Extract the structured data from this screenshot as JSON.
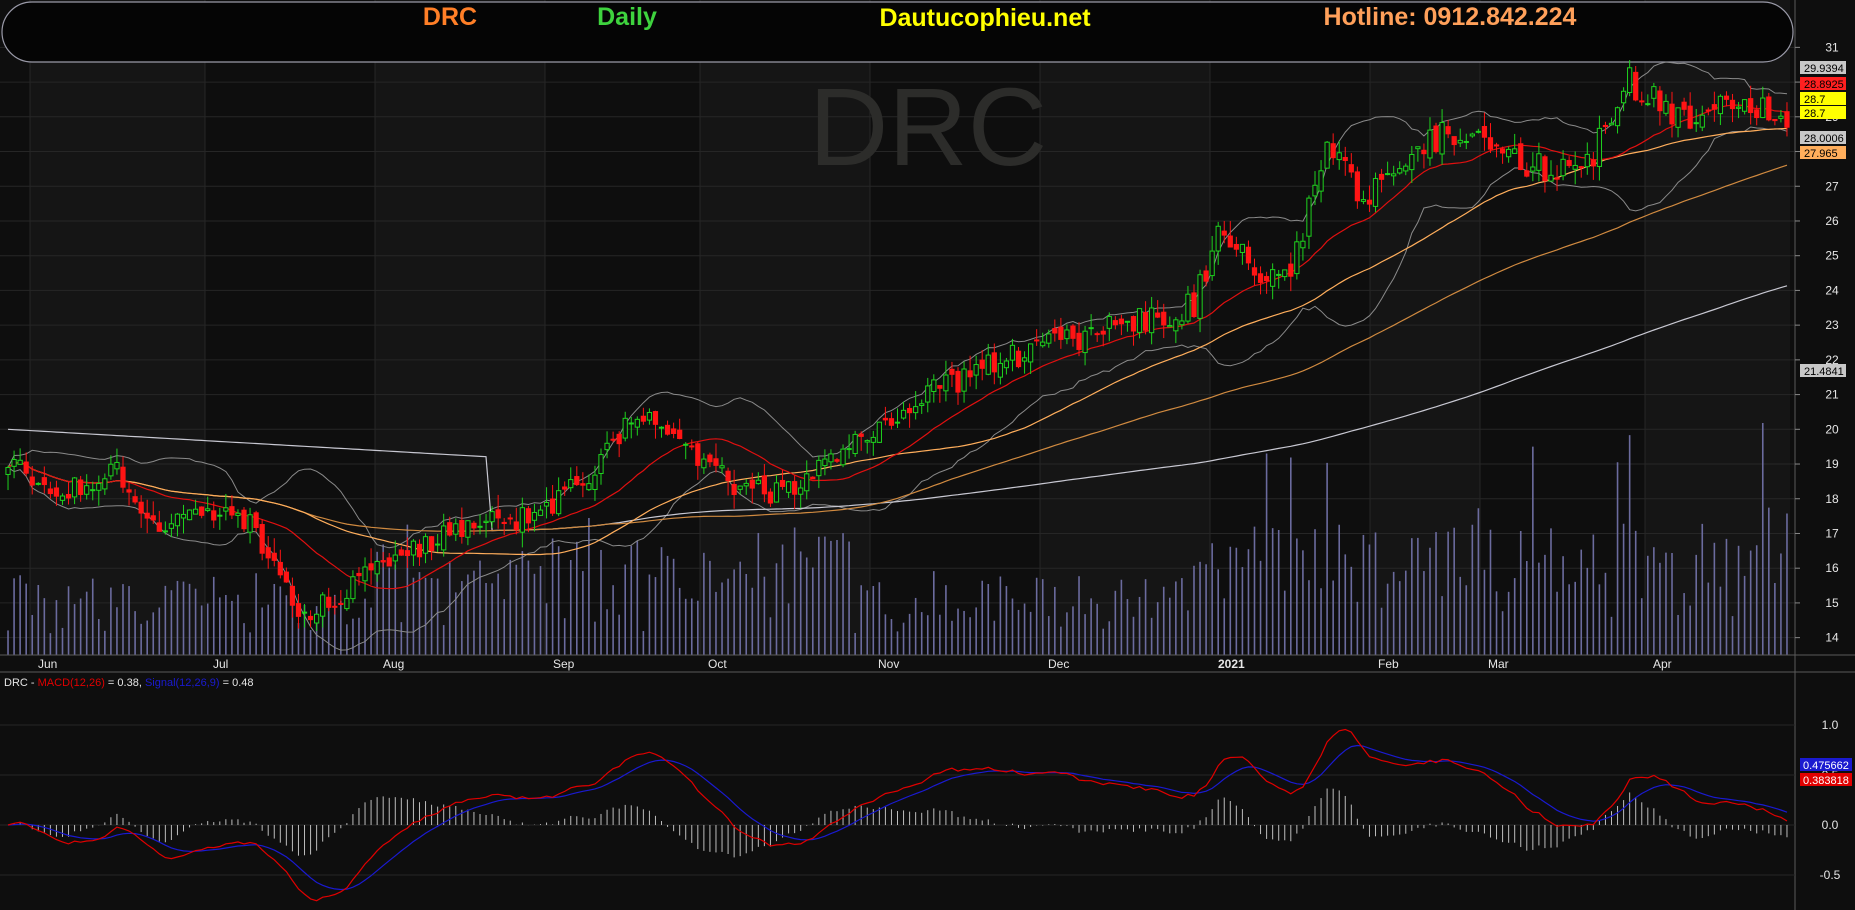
{
  "banner": {
    "ticker": "DRC",
    "period": "Daily",
    "site": "Dautucophieu.net",
    "hotline": "Hotline: 0912.842.224"
  },
  "watermark": "DRC",
  "colors": {
    "ticker": "#ff7f27",
    "period": "#3ed33e",
    "site": "#ffff00",
    "hotline": "#ffa05a",
    "up_candle": "#1ed21e",
    "down_candle": "#ff1414",
    "ma20": "#e01010",
    "ma50": "#ffae5c",
    "ma100": "#d08a40",
    "ma200": "#c8c8d2",
    "bollinger": "#8a8a8a",
    "volume": "#6b6b9e",
    "macd": "#e00000",
    "signal": "#1a1ad0"
  },
  "indicator_legend": {
    "ticker": "DRC",
    "separator": " - ",
    "macd_label": "MACD(12,26)",
    "macd_value": " = 0.38, ",
    "signal_label": "Signal(12,26,9)",
    "signal_value": " = 0.48"
  },
  "price_axis": {
    "ticks": [
      "31",
      "30",
      "29",
      "28",
      "27",
      "26",
      "25",
      "24",
      "23",
      "22",
      "21",
      "20",
      "19",
      "18",
      "17",
      "16",
      "15",
      "14"
    ],
    "tags": [
      {
        "text": "29.9394",
        "bg": "#c8c8c8",
        "fg": "#000000"
      },
      {
        "text": "28.8925",
        "bg": "#ff2020",
        "fg": "#000000"
      },
      {
        "text": "28.7",
        "bg": "#ffff00",
        "fg": "#000000"
      },
      {
        "text": "28.7",
        "bg": "#ffff00",
        "fg": "#000000"
      },
      {
        "text": "28.0006",
        "bg": "#c8c8c8",
        "fg": "#000000"
      },
      {
        "text": "27.965",
        "bg": "#ffae5c",
        "fg": "#000000"
      },
      {
        "text": "21.4841",
        "bg": "#c8c8c8",
        "fg": "#000000"
      }
    ]
  },
  "macd_axis": {
    "ticks": [
      "1.0",
      "0.5",
      "0.0",
      "-0.5"
    ],
    "tags": [
      {
        "text": "0.475662",
        "bg": "#1a1ad0",
        "fg": "#ffffff"
      },
      {
        "text": "0.383818",
        "bg": "#e00000",
        "fg": "#ffffff"
      }
    ]
  },
  "x_axis": {
    "labels": [
      "Jun",
      "Jul",
      "Aug",
      "Sep",
      "Oct",
      "Nov",
      "Dec",
      "2021",
      "Feb",
      "Mar",
      "Apr"
    ]
  },
  "chart_data": [
    {
      "type": "candlestick",
      "title": "DRC Daily",
      "ylim": [
        13.5,
        31.5
      ],
      "grid": true,
      "x_labels": [
        "Jun",
        "Jul",
        "Aug",
        "Sep",
        "Oct",
        "Nov",
        "Dec",
        "2021",
        "Feb",
        "Mar",
        "Apr"
      ],
      "key_points": [
        {
          "period": "Jun",
          "close": 19.0
        },
        {
          "period": "Jul",
          "close": 17.5
        },
        {
          "period": "Aug (low)",
          "close": 14.6
        },
        {
          "period": "Sep",
          "close": 17.0
        },
        {
          "period": "Oct",
          "close": 20.5
        },
        {
          "period": "Nov (pullback)",
          "close": 18.0
        },
        {
          "period": "Dec",
          "close": 21.0
        },
        {
          "period": "2021",
          "close": 23.0
        },
        {
          "period": "Feb",
          "close": 27.0
        },
        {
          "period": "Mar",
          "close": 28.0
        },
        {
          "period": "Apr",
          "close": 28.7
        }
      ],
      "last_close": 28.7,
      "reference_values": {
        "bollinger_upper": 29.9394,
        "ma20": 28.8925,
        "bollinger_lower": 28.0006,
        "ma50": 27.965,
        "ma200": 21.4841
      }
    },
    {
      "type": "line",
      "title": "MACD(12,26) / Signal(12,26,9)",
      "ylim": [
        -0.75,
        1.35
      ],
      "series": [
        {
          "name": "MACD(12,26)",
          "last": 0.383818
        },
        {
          "name": "Signal(12,26,9)",
          "last": 0.475662
        }
      ]
    }
  ]
}
